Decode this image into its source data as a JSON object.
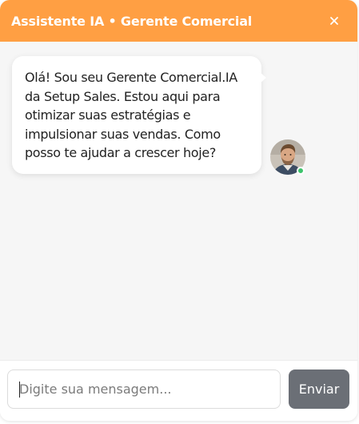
{
  "header": {
    "title": "Assistente IA • Gerente Comercial",
    "close_icon": "close-icon",
    "background_color": "#ff9f43"
  },
  "messages": [
    {
      "sender": "assistant",
      "text": "Olá! Sou seu Gerente Comercial.IA da Setup Sales. Estou aqui para otimizar suas estratégias e impulsionar suas vendas. Como posso te ajudar a crescer hoje?",
      "avatar": "avatar-photo",
      "status_color": "#3cc36b"
    }
  ],
  "composer": {
    "placeholder": "Digite sua mensagem...",
    "value": "",
    "send_label": "Enviar",
    "send_color": "#6b6f76"
  }
}
